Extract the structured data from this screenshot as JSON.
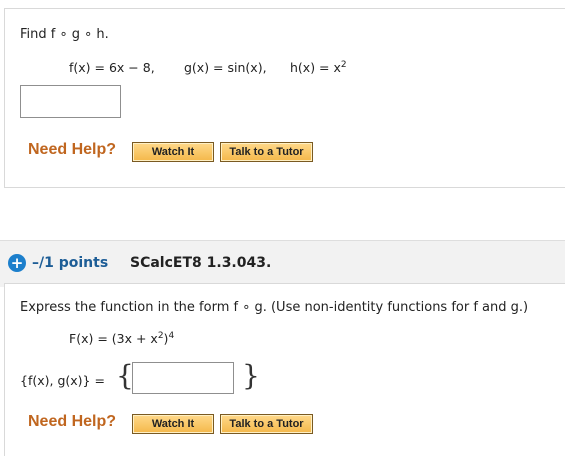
{
  "q1": {
    "prompt_text": "Find f ∘ g ∘ h.",
    "functions": {
      "f": "f(x) = 6x − 8,",
      "g": "g(x) = sin(x),",
      "h": "h(x) = x",
      "h_exp": "2"
    },
    "answer_value": "",
    "need_help": "Need Help?",
    "watch_it": "Watch It",
    "talk_tutor": "Talk to a Tutor"
  },
  "q2": {
    "points": "–/1 points",
    "problem_id": "SCalcET8 1.3.043.",
    "prompt_text": "Express the function in the form f ∘ g. (Use non-identity functions for f and g.)",
    "F_main": "F(x) = (3x + x",
    "F_inner_exp": "2",
    "F_close": ")",
    "F_outer_exp": "4",
    "set_label": "{f(x), g(x)} =",
    "brace_open": "{",
    "brace_close": "}",
    "answer_value": "",
    "need_help": "Need Help?",
    "watch_it": "Watch It",
    "talk_tutor": "Talk to a Tutor"
  },
  "icons": {
    "points_icon": "plus-circle-icon"
  },
  "colors": {
    "need_help": "#c0661f",
    "points_text": "#1d5d96",
    "plus_icon": "#1c7fcc",
    "button_fill": "#f4b84a"
  }
}
